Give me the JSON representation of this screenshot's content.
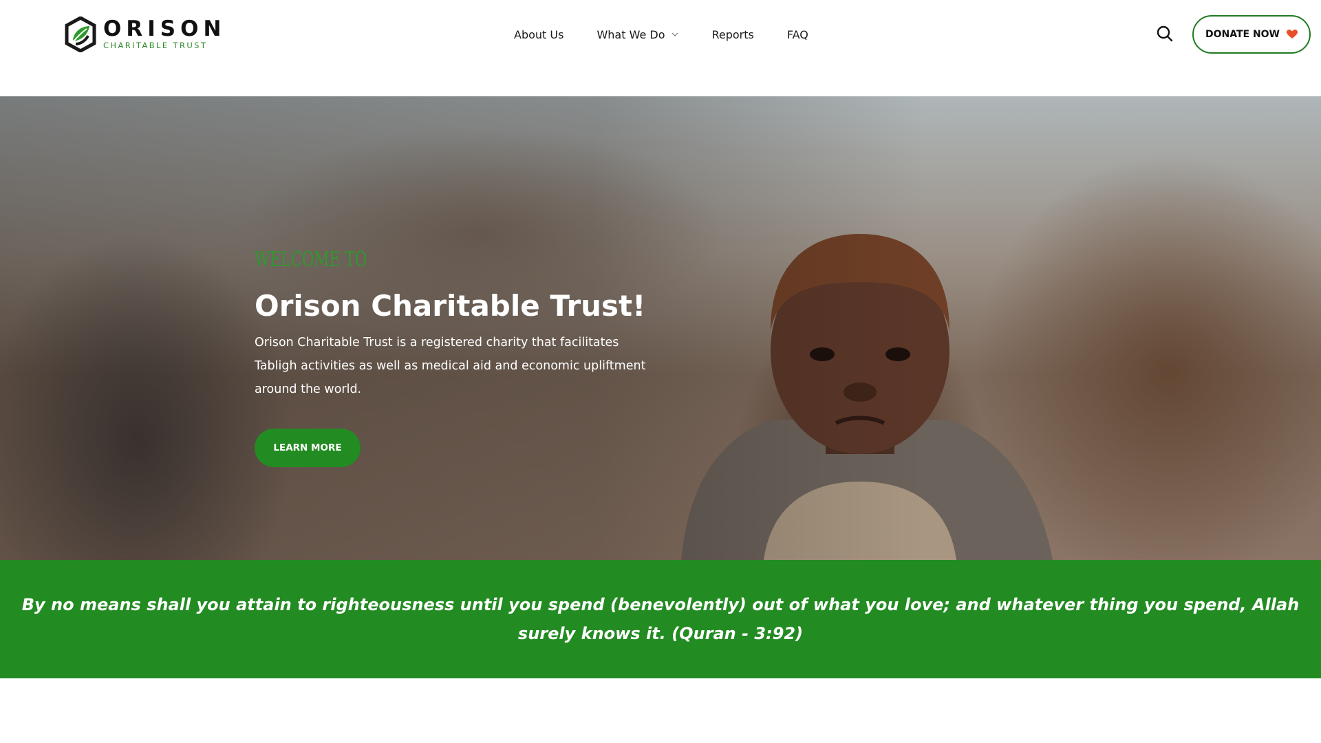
{
  "logo": {
    "name": "ORISON",
    "subtitle": "CHARITABLE TRUST"
  },
  "nav": {
    "items": [
      {
        "label": "About Us"
      },
      {
        "label": "What We Do"
      },
      {
        "label": "Reports"
      },
      {
        "label": "FAQ"
      }
    ]
  },
  "header": {
    "donate_label": "DONATE NOW"
  },
  "hero": {
    "eyebrow": "Welcome To",
    "title": "Orison Charitable Trust!",
    "description": "Orison Charitable Trust is a registered charity that facilitates Tabligh activities as well as medical aid and economic upliftment around the world.",
    "cta_label": "LEARN MORE"
  },
  "quote": {
    "text": "By no means shall you attain to righteousness until you spend (benevolently) out of what you love; and whatever thing you spend, Allah surely knows it. (Quran - 3:92)"
  },
  "colors": {
    "brand_green": "#228b22",
    "heart": "#e8502a"
  },
  "icons": {
    "search": "search-icon",
    "heart": "heart-icon",
    "caret": "chevron-down-icon"
  }
}
